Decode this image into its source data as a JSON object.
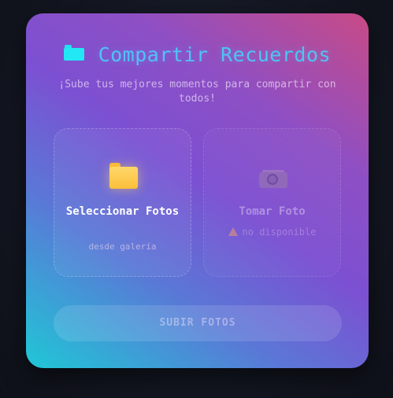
{
  "header": {
    "icon": "folder-icon",
    "title": "Compartir Recuerdos",
    "subtitle": "¡Sube tus mejores momentos para compartir con todos!"
  },
  "options": [
    {
      "icon": "folder-icon",
      "title": "Seleccionar Fotos",
      "subtitle": "desde galería",
      "enabled": true
    },
    {
      "icon": "camera-icon",
      "title": "Tomar Foto",
      "warning_icon": "warning-icon",
      "warning": "no disponible",
      "enabled": false
    }
  ],
  "upload_button": {
    "label": "SUBIR FOTOS",
    "enabled": false
  },
  "colors": {
    "title": "#4fc3f7",
    "gradient_top_right": "#c84a86",
    "gradient_mid": "#7c50d2",
    "gradient_bottom_left": "#1fc7d6",
    "folder": "#fbbf3a",
    "warning": "#f0a070"
  }
}
